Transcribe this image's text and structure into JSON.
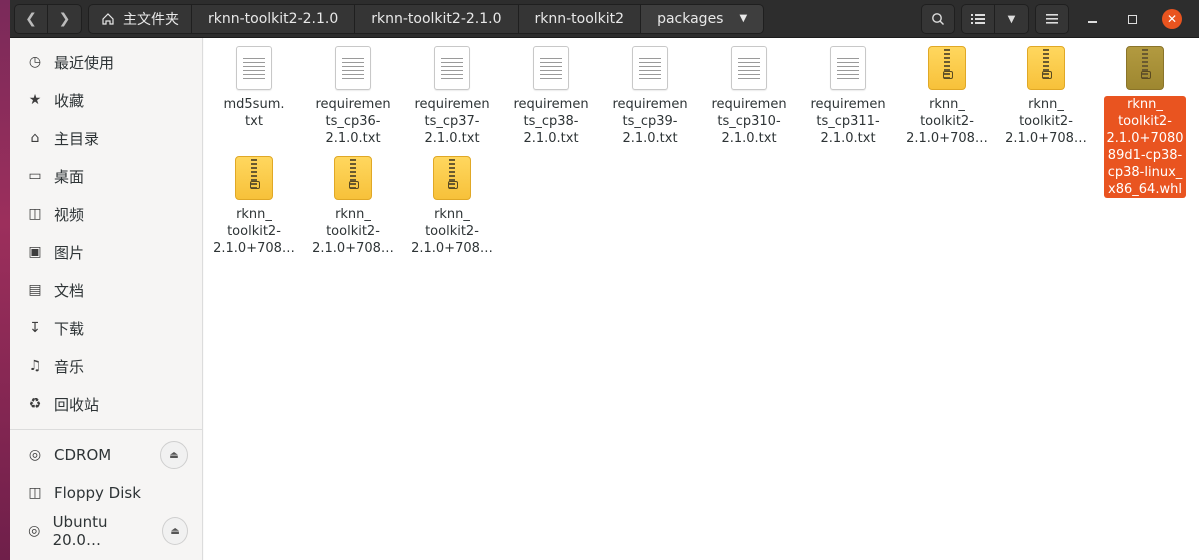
{
  "header": {
    "breadcrumbs": [
      "主文件夹",
      "rknn-toolkit2-2.1.0",
      "rknn-toolkit2-2.1.0",
      "rknn-toolkit2",
      "packages"
    ]
  },
  "sidebar": {
    "places": [
      {
        "label": "最近使用",
        "icon": "clock-icon"
      },
      {
        "label": "收藏",
        "icon": "star-icon"
      },
      {
        "label": "主目录",
        "icon": "home-icon"
      },
      {
        "label": "桌面",
        "icon": "desktop-icon"
      },
      {
        "label": "视频",
        "icon": "video-icon"
      },
      {
        "label": "图片",
        "icon": "image-icon"
      },
      {
        "label": "文档",
        "icon": "document-icon"
      },
      {
        "label": "下载",
        "icon": "download-icon"
      },
      {
        "label": "音乐",
        "icon": "music-icon"
      },
      {
        "label": "回收站",
        "icon": "trash-icon"
      }
    ],
    "devices": [
      {
        "label": "CDROM",
        "icon": "disc-icon",
        "eject": true
      },
      {
        "label": "Floppy Disk",
        "icon": "drive-icon",
        "eject": false
      },
      {
        "label": "Ubuntu 20.0…",
        "icon": "disc-icon",
        "eject": true
      }
    ]
  },
  "files": [
    {
      "name": "md5sum.\ntxt",
      "type": "text"
    },
    {
      "name": "requiremen\nts_cp36-\n2.1.0.txt",
      "type": "text"
    },
    {
      "name": "requiremen\nts_cp37-\n2.1.0.txt",
      "type": "text"
    },
    {
      "name": "requiremen\nts_cp38-\n2.1.0.txt",
      "type": "text"
    },
    {
      "name": "requiremen\nts_cp39-\n2.1.0.txt",
      "type": "text"
    },
    {
      "name": "requiremen\nts_cp310-\n2.1.0.txt",
      "type": "text"
    },
    {
      "name": "requiremen\nts_cp311-\n2.1.0.txt",
      "type": "text"
    },
    {
      "name": "rknn_\ntoolkit2-\n2.1.0+708…",
      "type": "archive"
    },
    {
      "name": "rknn_\ntoolkit2-\n2.1.0+708…",
      "type": "archive"
    },
    {
      "name": "rknn_\ntoolkit2-\n2.1.0+7080\n89d1-cp38-\ncp38-linux_\nx86_64.whl",
      "type": "archive",
      "selected": true
    },
    {
      "name": "rknn_\ntoolkit2-\n2.1.0+708…",
      "type": "archive"
    },
    {
      "name": "rknn_\ntoolkit2-\n2.1.0+708…",
      "type": "archive"
    },
    {
      "name": "rknn_\ntoolkit2-\n2.1.0+708…",
      "type": "archive"
    }
  ],
  "colors": {
    "accent": "#e95420",
    "archive": "#f7c13a",
    "header": "#2d2d2d"
  }
}
